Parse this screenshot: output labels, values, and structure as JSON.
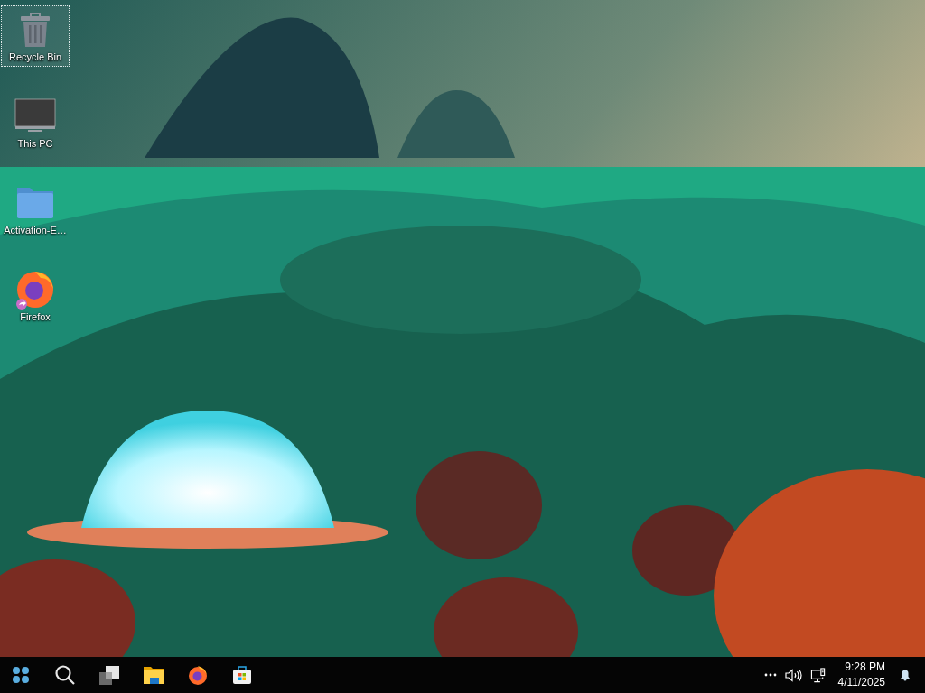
{
  "desktop_icons": [
    {
      "label": "Recycle Bin",
      "kind": "recycle",
      "selected": true
    },
    {
      "label": "This PC",
      "kind": "pc",
      "selected": false
    },
    {
      "label": "Activation-E…",
      "kind": "folder",
      "selected": false
    },
    {
      "label": "Firefox",
      "kind": "firefox",
      "selected": false
    }
  ],
  "taskbar": {
    "apps": [
      {
        "kind": "start"
      },
      {
        "kind": "search"
      },
      {
        "kind": "taskview"
      },
      {
        "kind": "explorer"
      },
      {
        "kind": "firefox"
      },
      {
        "kind": "store"
      }
    ],
    "clock": {
      "time": "9:28 PM",
      "date": "4/11/2025"
    }
  }
}
